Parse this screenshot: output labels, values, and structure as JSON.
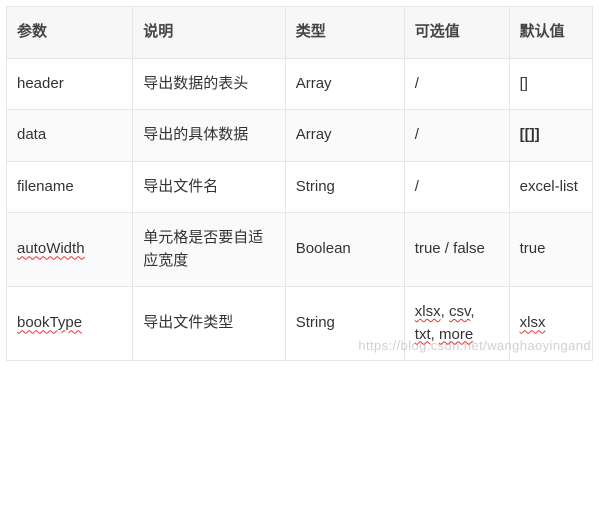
{
  "headers": {
    "param": "参数",
    "desc": "说明",
    "type": "类型",
    "options": "可选值",
    "default": "默认值"
  },
  "rows": [
    {
      "param": "header",
      "param_spell": false,
      "desc": "导出数据的表头",
      "type": "Array",
      "options": "/",
      "options_spell": false,
      "default": "[]",
      "default_spell": false
    },
    {
      "param": "data",
      "param_spell": false,
      "desc": "导出的具体数据",
      "type": "Array",
      "options": "/",
      "options_spell": false,
      "default": "[[]]",
      "default_spell": false
    },
    {
      "param": "filename",
      "param_spell": false,
      "desc": "导出文件名",
      "type": "String",
      "options": "/",
      "options_spell": false,
      "default": "excel-list",
      "default_spell": false
    },
    {
      "param": "autoWidth",
      "param_spell": true,
      "desc": "单元格是否要自适应宽度",
      "type": "Boolean",
      "options": "true / false",
      "options_spell": false,
      "default": "true",
      "default_spell": false
    },
    {
      "param": "bookType",
      "param_spell": true,
      "desc": "导出文件类型",
      "type": "String",
      "options": "",
      "options_spell": false,
      "default": "xlsx",
      "default_spell": true
    }
  ],
  "row4_options": {
    "a": "xlsx",
    "b": "csv",
    "c": "txt",
    "d": "more"
  },
  "watermark": "https://blog.csdn.net/wanghaoyingand"
}
